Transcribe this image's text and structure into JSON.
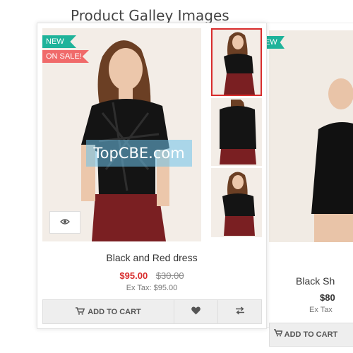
{
  "section": {
    "title": "Product Galley Images"
  },
  "product": {
    "badges": {
      "new": "NEW",
      "sale": "ON SALE!"
    },
    "name": "Black and Red dress",
    "price_new": "$95.00",
    "price_old": "$30.00",
    "ex_tax": "Ex Tax: $95.00",
    "add_to_cart": "ADD TO CART",
    "thumbnails": 3
  },
  "second_product": {
    "badge_new": "NEW",
    "name": "Black Sh",
    "price": "$80",
    "ex_tax": "Ex Tax",
    "add_to_cart": "ADD TO CART"
  },
  "watermark": "TopCBE.com",
  "bottom": {
    "text": "... ."
  },
  "colors": {
    "accent_red": "#d82c2c",
    "badge_new": "#1fb39a",
    "badge_sale": "#f06a6a"
  },
  "icons": {
    "quickview": "eye-icon",
    "cart": "cart-icon",
    "wishlist": "heart-icon",
    "compare": "compare-arrows-icon"
  }
}
